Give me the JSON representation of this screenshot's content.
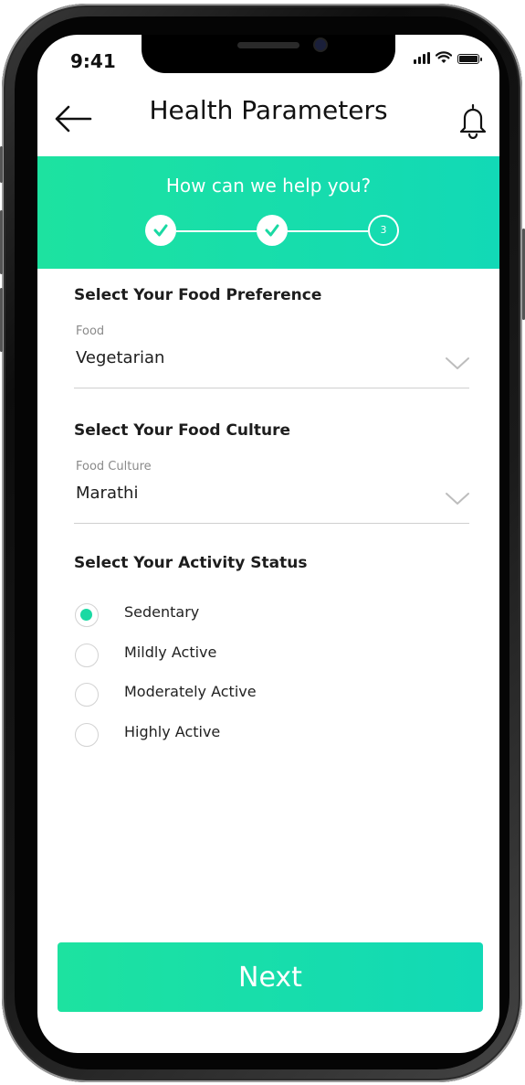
{
  "status_bar": {
    "time": "9:41"
  },
  "header": {
    "title": "Health Parameters"
  },
  "banner": {
    "prompt": "How can we help you?",
    "steps": [
      {
        "state": "done"
      },
      {
        "state": "done"
      },
      {
        "state": "current",
        "label": "3"
      }
    ]
  },
  "food_preference": {
    "section_title": "Select Your Food Preference",
    "label": "Food",
    "value": "Vegetarian"
  },
  "food_culture": {
    "section_title": "Select Your Food Culture",
    "label": "Food Culture",
    "value": "Marathi"
  },
  "activity": {
    "section_title": "Select Your Activity Status",
    "options": [
      {
        "label": "Sedentary",
        "selected": true
      },
      {
        "label": "Mildly Active",
        "selected": false
      },
      {
        "label": "Moderately Active",
        "selected": false
      },
      {
        "label": "Highly Active",
        "selected": false
      }
    ]
  },
  "next_button": {
    "label": "Next"
  },
  "colors": {
    "accent": "#1de2a0",
    "accent_end": "#12d9b6",
    "text": "#1d1d1d",
    "muted": "#8a8a8a"
  },
  "icons": [
    "back-arrow-icon",
    "bell-icon",
    "check-icon",
    "chevron-down-icon",
    "signal-icon",
    "wifi-icon",
    "battery-icon"
  ]
}
